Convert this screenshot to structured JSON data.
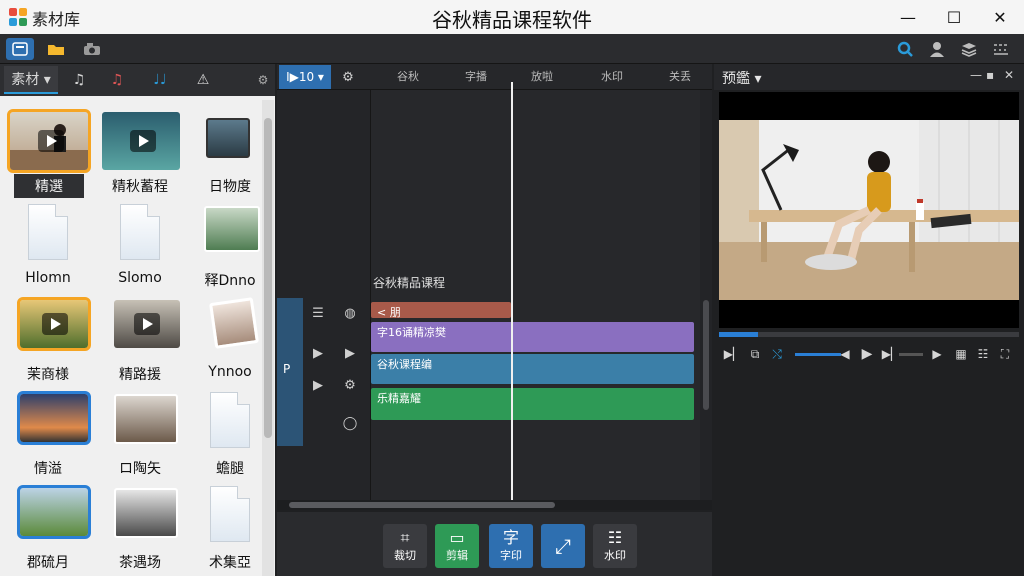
{
  "app": {
    "name": "素材库",
    "title": "谷秋精品课程软件"
  },
  "window_controls": {
    "minimize": "—",
    "maximize": "☐",
    "close": "✕"
  },
  "left_panel": {
    "tabs": [
      {
        "label": "素材 ▾",
        "icon": "dropdown"
      },
      {
        "label": "♫",
        "icon": "music-note-icon"
      },
      {
        "label": "♫",
        "icon": "music-red-icon"
      },
      {
        "label": "♩♩",
        "icon": "double-note-icon"
      },
      {
        "label": "⚠",
        "icon": "warning-icon"
      }
    ],
    "items": [
      {
        "label": "精選",
        "kind": "video",
        "selected": true
      },
      {
        "label": "精秋蓄程",
        "kind": "video"
      },
      {
        "label": "日物度",
        "kind": "photo"
      },
      {
        "label": "Hlomn",
        "kind": "doc"
      },
      {
        "label": "Slomo",
        "kind": "doc"
      },
      {
        "label": "释Dnno",
        "kind": "photo"
      },
      {
        "label": "茉商様",
        "kind": "video"
      },
      {
        "label": "精路援",
        "kind": "video"
      },
      {
        "label": "Ynnoo",
        "kind": "photo"
      },
      {
        "label": "情溢",
        "kind": "photo"
      },
      {
        "label": "ロ陶矢",
        "kind": "photo"
      },
      {
        "label": "蟾腿",
        "kind": "doc"
      },
      {
        "label": "郡硫月",
        "kind": "photo"
      },
      {
        "label": "茶遇场",
        "kind": "photo"
      },
      {
        "label": "术集亞",
        "kind": "doc"
      }
    ]
  },
  "timeline": {
    "control_label": "I▶10 ▾",
    "ruler": [
      "谷秋",
      "字播",
      "放啦",
      "水印",
      "关丢"
    ],
    "track_title": "谷秋精品课程",
    "clips": [
      {
        "label": "< 朋",
        "color": "#a85a4a"
      },
      {
        "label": "字16诵精凉樊",
        "color": "#8a6fc0"
      },
      {
        "label": "谷秋课程编",
        "color": "#3b7fa8"
      },
      {
        "label": "乐精嘉耀",
        "color": "#2e9a56"
      }
    ],
    "gutter_play": "P"
  },
  "bottom_tools": [
    {
      "label": "裁切",
      "glyph": "⌗",
      "color": "#3a3b3f"
    },
    {
      "label": "剪辑",
      "glyph": "▭",
      "color": "#2e9a56"
    },
    {
      "label": "字印",
      "glyph": "字",
      "color": "#2e6fb0"
    },
    {
      "label": "",
      "glyph": "⤢",
      "color": "#2e6fb0"
    },
    {
      "label": "水印",
      "glyph": "☷",
      "color": "#3a3b3f"
    }
  ],
  "preview": {
    "title": "预鑑 ▾",
    "progress": 0.13
  },
  "colors": {
    "accent_blue": "#2a7fd6",
    "selection_orange": "#f5a524"
  }
}
